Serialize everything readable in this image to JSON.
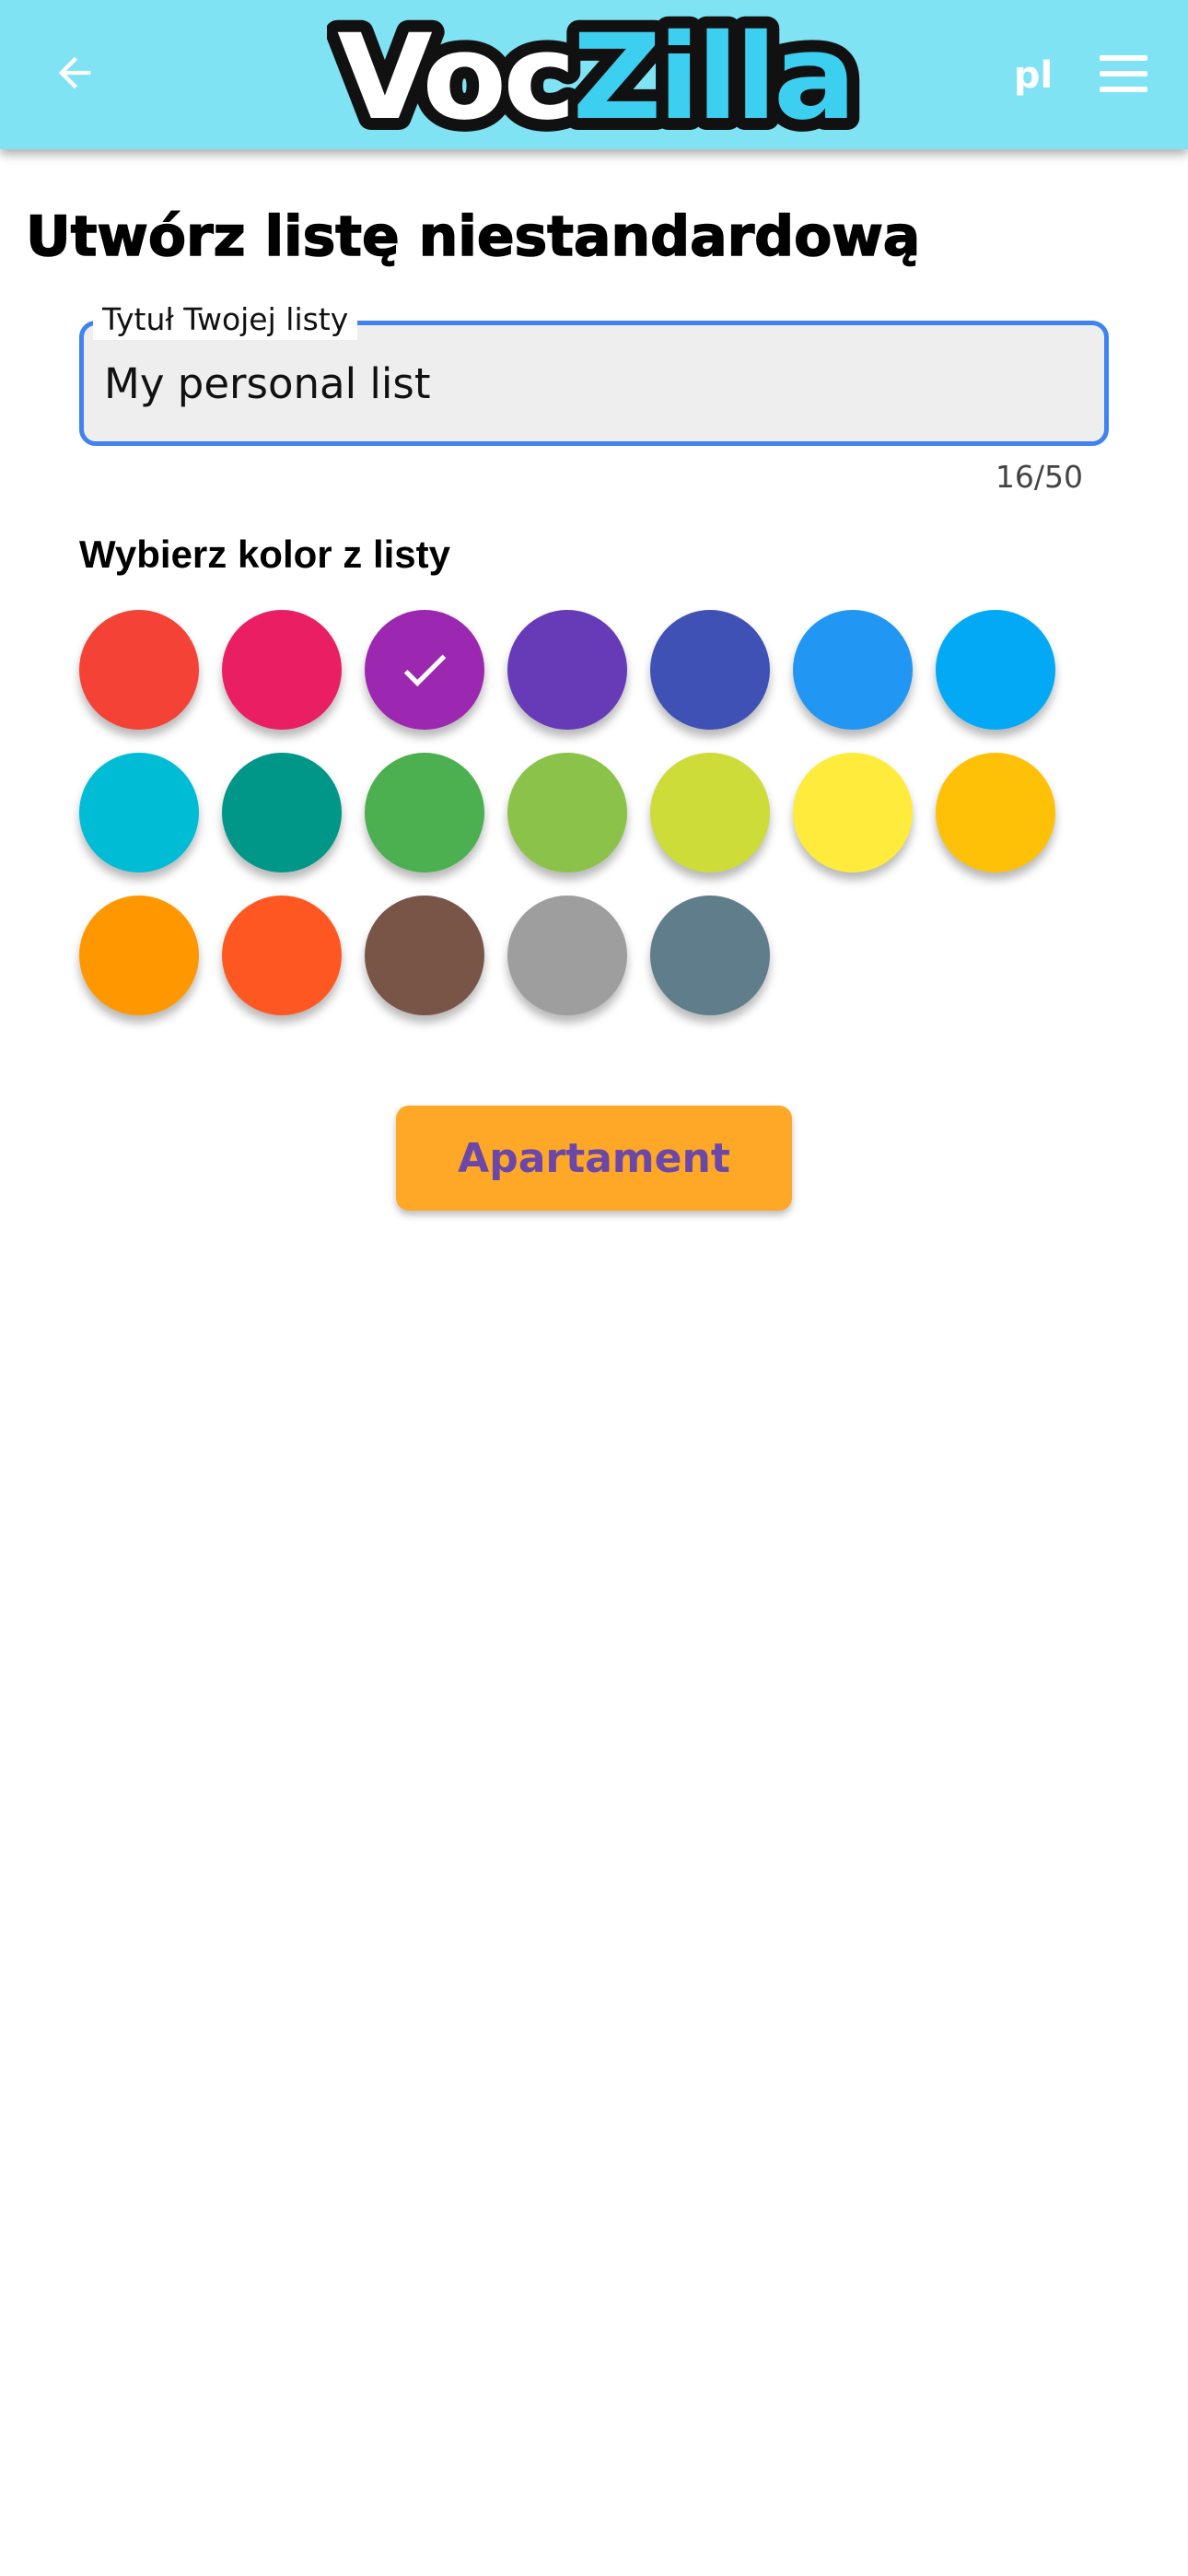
{
  "header": {
    "back_icon": "arrow-left-icon",
    "logo": {
      "part1": "Voc",
      "part2": "Zilla",
      "part1_color": "#ffffff",
      "part2_color": "#3ccfef",
      "outline_color": "#111111"
    },
    "language": "pl",
    "menu_icon": "hamburger-menu-icon",
    "background": "#7fe3f3"
  },
  "page": {
    "title": "Utwórz listę niestandardową"
  },
  "title_field": {
    "label": "Tytuł Twojej listy",
    "value": "My personal list",
    "counter": "16/50",
    "focus_color": "#3f82f0"
  },
  "color_picker": {
    "heading": "Wybierz kolor z listy",
    "selected_index": 2,
    "check_icon": "check-icon",
    "colors": [
      "#f44336",
      "#e91e63",
      "#9c27b0",
      "#673ab7",
      "#3f51b5",
      "#2196f3",
      "#03a9f4",
      "#00bcd4",
      "#009688",
      "#4caf50",
      "#8bc34a",
      "#cddc39",
      "#ffeb3b",
      "#ffc107",
      "#ff9800",
      "#ff5722",
      "#795548",
      "#9e9e9e",
      "#607d8b"
    ]
  },
  "submit_button": {
    "label": "Apartament",
    "background": "#ffa726",
    "text_color": "#6b47a8"
  }
}
